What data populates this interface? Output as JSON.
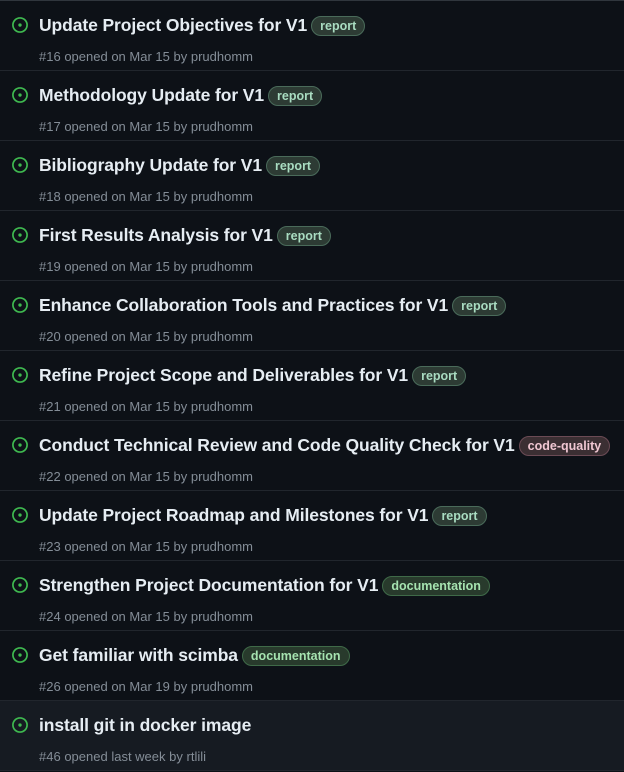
{
  "colors": {
    "open_icon": "#3fb950",
    "background": "#0d1117",
    "row_hover": "#161b22",
    "muted_text": "#848d97"
  },
  "icons": {
    "status": "issue-opened-icon"
  },
  "issues": [
    {
      "title": "Update Project Objectives for V1",
      "label": "report",
      "label_class": "report",
      "number": "#16",
      "opened": "opened on Mar 15",
      "by": "by",
      "author": "prudhomm"
    },
    {
      "title": "Methodology Update for V1",
      "label": "report",
      "label_class": "report",
      "number": "#17",
      "opened": "opened on Mar 15",
      "by": "by",
      "author": "prudhomm"
    },
    {
      "title": "Bibliography Update for V1",
      "label": "report",
      "label_class": "report",
      "number": "#18",
      "opened": "opened on Mar 15",
      "by": "by",
      "author": "prudhomm"
    },
    {
      "title": "First Results Analysis for V1",
      "label": "report",
      "label_class": "report",
      "number": "#19",
      "opened": "opened on Mar 15",
      "by": "by",
      "author": "prudhomm"
    },
    {
      "title": "Enhance Collaboration Tools and Practices for V1",
      "label": "report",
      "label_class": "report",
      "number": "#20",
      "opened": "opened on Mar 15",
      "by": "by",
      "author": "prudhomm"
    },
    {
      "title": "Refine Project Scope and Deliverables for V1",
      "label": "report",
      "label_class": "report",
      "number": "#21",
      "opened": "opened on Mar 15",
      "by": "by",
      "author": "prudhomm"
    },
    {
      "title": "Conduct Technical Review and Code Quality Check for V1",
      "label": "code-quality",
      "label_class": "code-quality",
      "number": "#22",
      "opened": "opened on Mar 15",
      "by": "by",
      "author": "prudhomm"
    },
    {
      "title": "Update Project Roadmap and Milestones for V1",
      "label": "report",
      "label_class": "report",
      "number": "#23",
      "opened": "opened on Mar 15",
      "by": "by",
      "author": "prudhomm"
    },
    {
      "title": "Strengthen Project Documentation for V1",
      "label": "documentation",
      "label_class": "documentation",
      "number": "#24",
      "opened": "opened on Mar 15",
      "by": "by",
      "author": "prudhomm"
    },
    {
      "title": "Get familiar with scimba",
      "label": "documentation",
      "label_class": "documentation",
      "number": "#26",
      "opened": "opened on Mar 19",
      "by": "by",
      "author": "prudhomm"
    },
    {
      "title": "install git in docker image",
      "label": "",
      "label_class": "",
      "number": "#46",
      "opened": "opened last week",
      "by": "by",
      "author": "rtlili"
    }
  ]
}
